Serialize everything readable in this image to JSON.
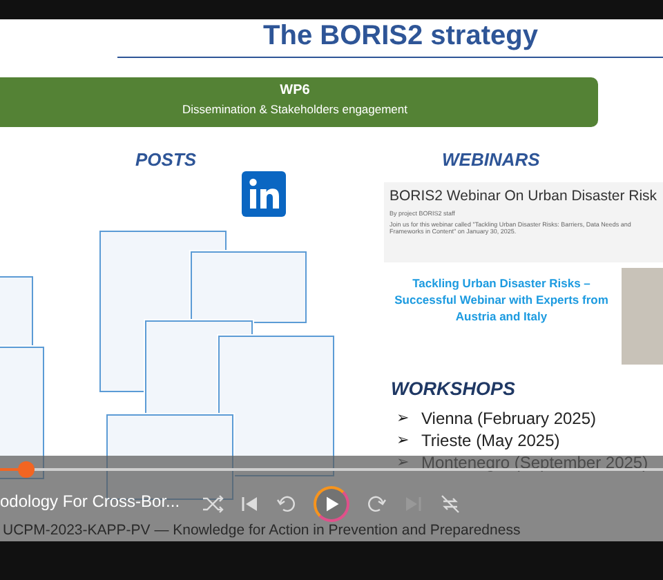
{
  "slide": {
    "title": "The BORIS2 strategy",
    "banner": {
      "heading": "WP6",
      "subtitle": "Dissemination & Stakeholders engagement"
    },
    "posts": {
      "heading": "POSTS"
    },
    "webinars": {
      "heading": "WEBINARS",
      "card_title": "BORIS2 Webinar On Urban Disaster Risk",
      "byline": "By project BORIS2 staff",
      "body": "Join us for this webinar called \"Tackling Urban Disaster Risks: Barriers, Data Needs and Frameworks in Content\" on January 30, 2025.",
      "highlight": "Tackling Urban Disaster Risks – Successful Webinar with Experts from Austria and Italy"
    },
    "workshops": {
      "heading": "WORKSHOPS",
      "items": [
        {
          "bullet": "➢",
          "text": "Vienna (February 2025)"
        },
        {
          "bullet": "➢",
          "text": "Trieste (May 2025)"
        },
        {
          "bullet": "➢",
          "text": "Montenegro (September 2025)"
        }
      ]
    }
  },
  "player": {
    "title": "odology For Cross-Bor...",
    "subtitle": "UCPM-2023-KAPP-PV — Knowledge for Action in Prevention and Preparedness",
    "progress": {
      "level": 0.04
    },
    "playing": false
  }
}
